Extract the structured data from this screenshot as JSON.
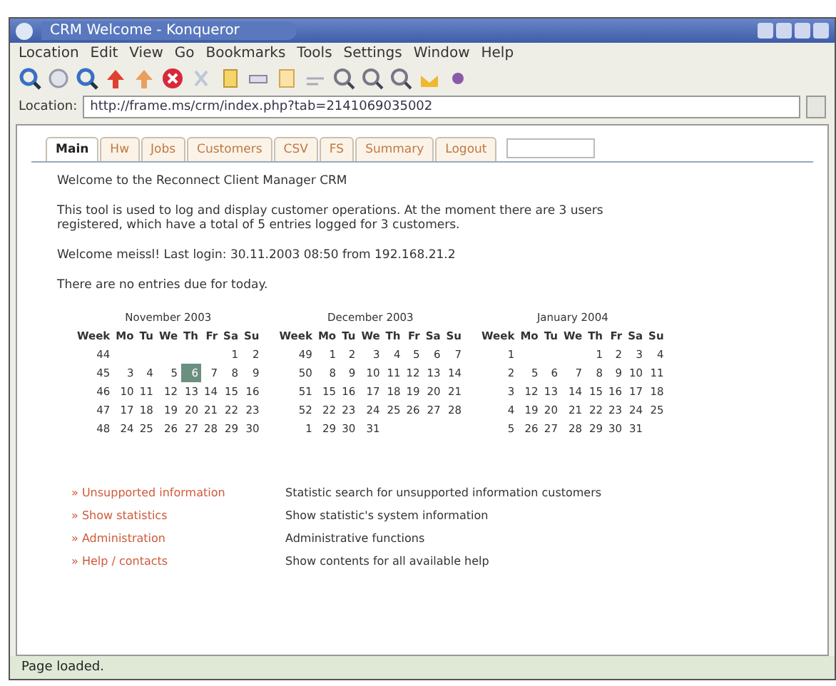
{
  "window": {
    "title": "CRM Welcome - Konqueror"
  },
  "menu": [
    "Location",
    "Edit",
    "View",
    "Go",
    "Bookmarks",
    "Tools",
    "Settings",
    "Window",
    "Help"
  ],
  "location": {
    "label": "Location:",
    "url": "http://frame.ms/crm/index.php?tab=2141069035002"
  },
  "tabs": [
    {
      "label": "Main",
      "selected": true
    },
    {
      "label": "Hw",
      "selected": false
    },
    {
      "label": "Jobs",
      "selected": false
    },
    {
      "label": "Customers",
      "selected": false
    },
    {
      "label": "CSV",
      "selected": false
    },
    {
      "label": "FS",
      "selected": false
    },
    {
      "label": "Summary",
      "selected": false
    },
    {
      "label": "Logout",
      "selected": false
    }
  ],
  "paragraphs": [
    "Welcome to the Reconnect Client Manager CRM",
    "This tool is used to log and display customer operations. At the moment there are 3 users registered, which have a total of 5 entries logged for 3 customers.",
    "Welcome meissl! Last login: 30.11.2003 08:50 from 192.168.21.2",
    "There are no entries due for today."
  ],
  "calendar": {
    "months": [
      {
        "title": "November 2003",
        "header": [
          "Week",
          "Mo",
          "Tu",
          "We",
          "Th",
          "Fr",
          "Sa",
          "Su"
        ],
        "weeks": [
          {
            "week": "44",
            "kind": "first",
            "days": [
              {
                "day": "1",
                "selected": false
              },
              {
                "day": "2",
                "selected": false
              }
            ]
          },
          {
            "week": "45",
            "kind": "full",
            "days": [
              {
                "day": "3",
                "selected": false
              },
              {
                "day": "4",
                "selected": false
              },
              {
                "day": "5",
                "selected": false
              },
              {
                "day": "6",
                "selected": true
              },
              {
                "day": "7",
                "selected": false
              },
              {
                "day": "8",
                "selected": false
              },
              {
                "day": "9",
                "selected": false
              }
            ]
          },
          {
            "week": "46",
            "kind": "full",
            "days": [
              {
                "day": "10",
                "selected": false
              },
              {
                "day": "11",
                "selected": false
              },
              {
                "day": "12",
                "selected": false
              },
              {
                "day": "13",
                "selected": false
              },
              {
                "day": "14",
                "selected": false
              },
              {
                "day": "15",
                "selected": false
              },
              {
                "day": "16",
                "selected": false
              }
            ]
          },
          {
            "week": "47",
            "kind": "full",
            "days": [
              {
                "day": "17",
                "selected": false
              },
              {
                "day": "18",
                "selected": false
              },
              {
                "day": "19",
                "selected": false
              },
              {
                "day": "20",
                "selected": false
              },
              {
                "day": "21",
                "selected": false
              },
              {
                "day": "22",
                "selected": false
              },
              {
                "day": "23",
                "selected": false
              }
            ]
          },
          {
            "week": "48",
            "kind": "full",
            "days": [
              {
                "day": "24",
                "selected": false
              },
              {
                "day": "25",
                "selected": false
              },
              {
                "day": "26",
                "selected": false
              },
              {
                "day": "27",
                "selected": false
              },
              {
                "day": "28",
                "selected": false
              },
              {
                "day": "29",
                "selected": false
              },
              {
                "day": "30",
                "selected": false
              }
            ]
          }
        ]
      },
      {
        "title": "December 2003",
        "header": [
          "Week",
          "Mo",
          "Tu",
          "We",
          "Th",
          "Fr",
          "Sa",
          "Su"
        ],
        "weeks": [
          {
            "week": "49",
            "kind": "full",
            "days": [
              {
                "day": "1",
                "selected": false
              },
              {
                "day": "2",
                "selected": false
              },
              {
                "day": "3",
                "selected": false
              },
              {
                "day": "4",
                "selected": false
              },
              {
                "day": "5",
                "selected": false
              },
              {
                "day": "6",
                "selected": false
              },
              {
                "day": "7",
                "selected": false
              }
            ]
          },
          {
            "week": "50",
            "kind": "full",
            "days": [
              {
                "day": "8",
                "selected": false
              },
              {
                "day": "9",
                "selected": false
              },
              {
                "day": "10",
                "selected": false
              },
              {
                "day": "11",
                "selected": false
              },
              {
                "day": "12",
                "selected": false
              },
              {
                "day": "13",
                "selected": false
              },
              {
                "day": "14",
                "selected": false
              }
            ]
          },
          {
            "week": "51",
            "kind": "full",
            "days": [
              {
                "day": "15",
                "selected": false
              },
              {
                "day": "16",
                "selected": false
              },
              {
                "day": "17",
                "selected": false
              },
              {
                "day": "18",
                "selected": false
              },
              {
                "day": "19",
                "selected": false
              },
              {
                "day": "20",
                "selected": false
              },
              {
                "day": "21",
                "selected": false
              }
            ]
          },
          {
            "week": "52",
            "kind": "full",
            "days": [
              {
                "day": "22",
                "selected": false
              },
              {
                "day": "23",
                "selected": false
              },
              {
                "day": "24",
                "selected": false
              },
              {
                "day": "25",
                "selected": false
              },
              {
                "day": "26",
                "selected": false
              },
              {
                "day": "27",
                "selected": false
              },
              {
                "day": "28",
                "selected": false
              }
            ]
          },
          {
            "week": "1",
            "kind": "last",
            "days": [
              {
                "day": "29",
                "selected": false
              },
              {
                "day": "30",
                "selected": false
              },
              {
                "day": "31",
                "selected": false
              }
            ]
          }
        ]
      },
      {
        "title": "January 2004",
        "header": [
          "Week",
          "Mo",
          "Tu",
          "We",
          "Th",
          "Fr",
          "Sa",
          "Su"
        ],
        "weeks": [
          {
            "week": "1",
            "kind": "first",
            "days": [
              {
                "day": "1",
                "selected": false
              },
              {
                "day": "2",
                "selected": false
              },
              {
                "day": "3",
                "selected": false
              },
              {
                "day": "4",
                "selected": false
              }
            ]
          },
          {
            "week": "2",
            "kind": "full",
            "days": [
              {
                "day": "5",
                "selected": false
              },
              {
                "day": "6",
                "selected": false
              },
              {
                "day": "7",
                "selected": false
              },
              {
                "day": "8",
                "selected": false
              },
              {
                "day": "9",
                "selected": false
              },
              {
                "day": "10",
                "selected": false
              },
              {
                "day": "11",
                "selected": false
              }
            ]
          },
          {
            "week": "3",
            "kind": "full",
            "days": [
              {
                "day": "12",
                "selected": false
              },
              {
                "day": "13",
                "selected": false
              },
              {
                "day": "14",
                "selected": false
              },
              {
                "day": "15",
                "selected": false
              },
              {
                "day": "16",
                "selected": false
              },
              {
                "day": "17",
                "selected": false
              },
              {
                "day": "18",
                "selected": false
              }
            ]
          },
          {
            "week": "4",
            "kind": "full",
            "days": [
              {
                "day": "19",
                "selected": false
              },
              {
                "day": "20",
                "selected": false
              },
              {
                "day": "21",
                "selected": false
              },
              {
                "day": "22",
                "selected": false
              },
              {
                "day": "23",
                "selected": false
              },
              {
                "day": "24",
                "selected": false
              },
              {
                "day": "25",
                "selected": false
              }
            ]
          },
          {
            "week": "5",
            "kind": "last",
            "days": [
              {
                "day": "26",
                "selected": false
              },
              {
                "day": "27",
                "selected": false
              },
              {
                "day": "28",
                "selected": false
              },
              {
                "day": "29",
                "selected": false
              },
              {
                "day": "30",
                "selected": false
              },
              {
                "day": "31",
                "selected": false
              }
            ]
          }
        ]
      }
    ]
  },
  "links": [
    {
      "bullet": "»",
      "label": "Unsupported information",
      "description": "Statistic search for unsupported information customers"
    },
    {
      "bullet": "»",
      "label": "Show statistics",
      "description": "Show statistic's system information"
    },
    {
      "bullet": "»",
      "label": "Administration",
      "description": "Administrative functions"
    },
    {
      "bullet": "»",
      "label": "Help / contacts",
      "description": "Show contents for all available help"
    }
  ],
  "status_bar": "Page loaded."
}
